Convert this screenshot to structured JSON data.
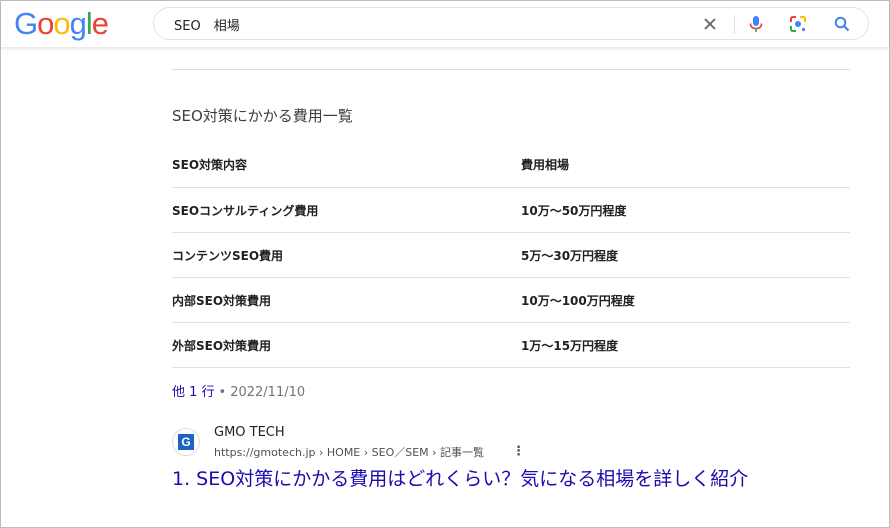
{
  "header": {
    "logo_letters": [
      "G",
      "o",
      "o",
      "g",
      "l",
      "e"
    ],
    "logo_colors": [
      "#4285F4",
      "#EA4335",
      "#FBBC05",
      "#4285F4",
      "#34A853",
      "#EA4335"
    ],
    "search_value": "SEO　相場",
    "icons": [
      "close-icon",
      "microphone-icon",
      "lens-icon",
      "search-icon"
    ]
  },
  "snippet": {
    "title": "SEO対策にかかる費用一覧",
    "table": {
      "headers": [
        "SEO対策内容",
        "費用相場"
      ],
      "rows": [
        [
          "SEOコンサルティング費用",
          "10万～50万円程度"
        ],
        [
          "コンテンツSEO費用",
          "5万～30万円程度"
        ],
        [
          "内部SEO対策費用",
          "10万～100万円程度"
        ],
        [
          "外部SEO対策費用",
          "1万～15万円程度"
        ]
      ]
    },
    "more_rows_link": "他 1 行",
    "separator": "•",
    "date": "2022/11/10"
  },
  "result": {
    "favicon_letter": "G",
    "site_name": "GMO TECH",
    "url": "https://gmotech.jp › HOME › SEO／SEM › 記事一覧",
    "title": "1. SEO対策にかかる費用はどれくらい？気になる相場を詳しく紹介"
  },
  "colors": {
    "link": "#1a0dab",
    "mic_blue": "#4285F4",
    "mic_red": "#EA4335"
  }
}
